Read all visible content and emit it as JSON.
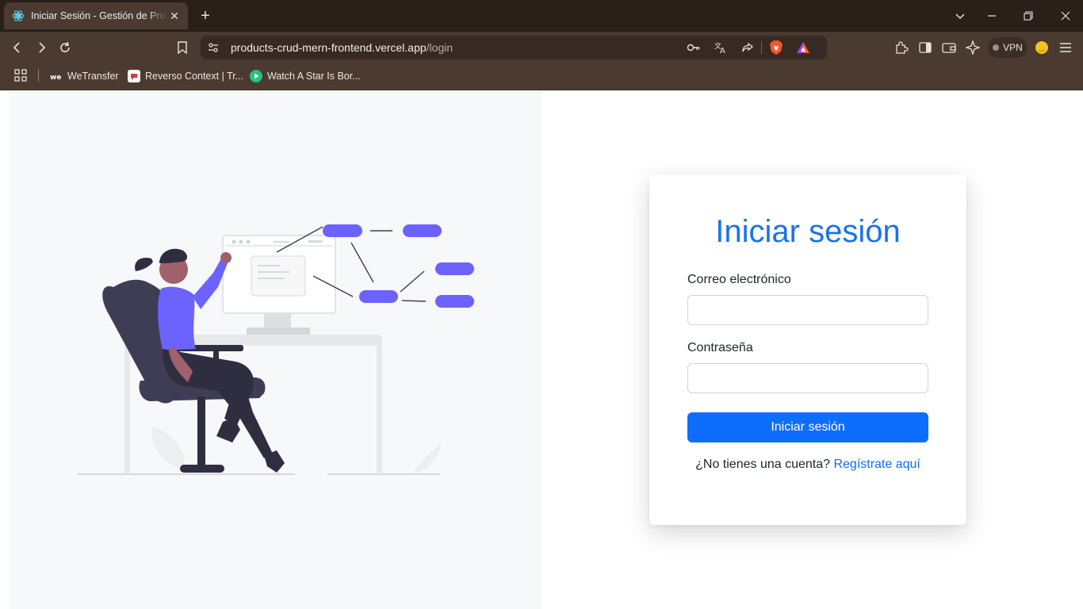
{
  "browser": {
    "tab_title": "Iniciar Sesión - Gestión de Productos",
    "url_host": "products-crud-mern-frontend.vercel.app",
    "url_path": "/login",
    "vpn_label": "VPN",
    "bookmarks": [
      {
        "label": "WeTransfer",
        "icon": "wetransfer-icon"
      },
      {
        "label": "Reverso Context | Tr...",
        "icon": "reverso-icon"
      },
      {
        "label": "Watch A Star Is Bor...",
        "icon": "play-icon"
      }
    ]
  },
  "login": {
    "title": "Iniciar sesión",
    "email_label": "Correo electrónico",
    "email_value": "",
    "password_label": "Contraseña",
    "password_value": "",
    "submit_label": "Iniciar sesión",
    "register_prompt": "¿No tienes una cuenta?",
    "register_link": "Regístrate aquí"
  },
  "colors": {
    "accent": "#0d6efd",
    "title": "#1a73e8",
    "illustration_accent": "#6c63ff",
    "browser_frame": "#4a3a30"
  }
}
